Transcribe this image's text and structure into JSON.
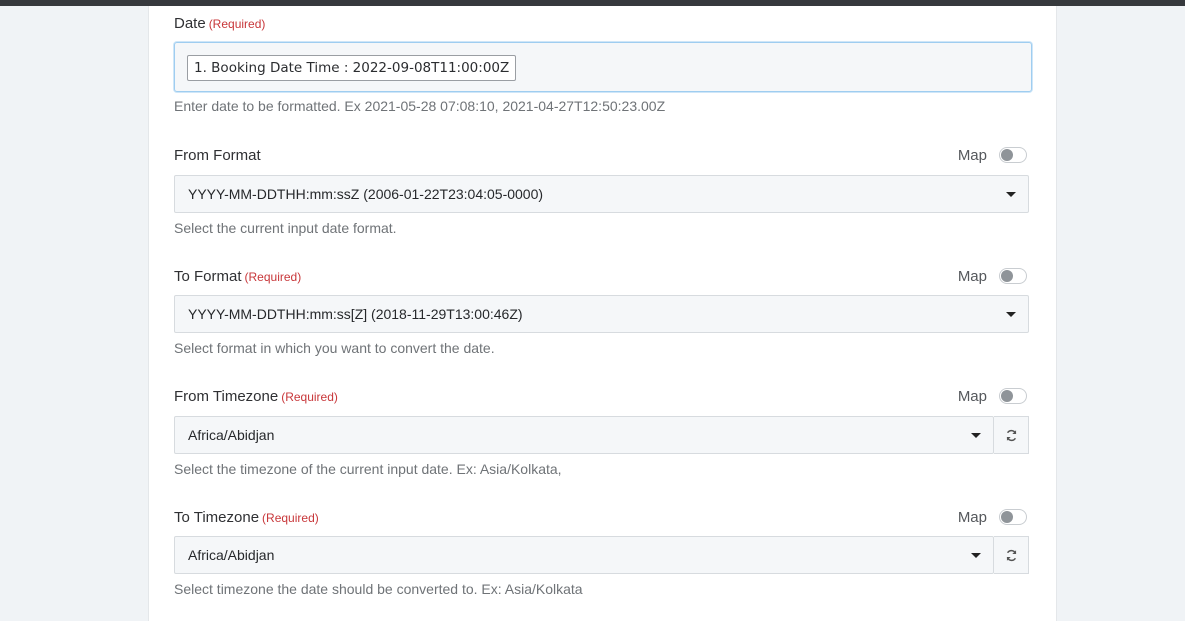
{
  "required_text": "(Required)",
  "map_label": "Map",
  "date": {
    "label": "Date",
    "chip_value": "1. Booking Date Time : 2022-09-08T11:00:00Z",
    "help": "Enter date to be formatted. Ex 2021-05-28 07:08:10, 2021-04-27T12:50:23.00Z"
  },
  "from_format": {
    "label": "From Format",
    "value": "YYYY-MM-DDTHH:mm:ssZ (2006-01-22T23:04:05-0000)",
    "help": "Select the current input date format.",
    "map_enabled": false
  },
  "to_format": {
    "label": "To Format",
    "value": "YYYY-MM-DDTHH:mm:ss[Z] (2018-11-29T13:00:46Z)",
    "help": "Select format in which you want to convert the date.",
    "map_enabled": false
  },
  "from_timezone": {
    "label": "From Timezone",
    "value": "Africa/Abidjan",
    "help": "Select the timezone of the current input date. Ex: Asia/Kolkata,",
    "map_enabled": false
  },
  "to_timezone": {
    "label": "To Timezone",
    "value": "Africa/Abidjan",
    "help": "Select timezone the date should be converted to. Ex: Asia/Kolkata",
    "map_enabled": false
  },
  "icons": {
    "dropdown": "caret-down-icon",
    "refresh": "refresh-icon"
  }
}
